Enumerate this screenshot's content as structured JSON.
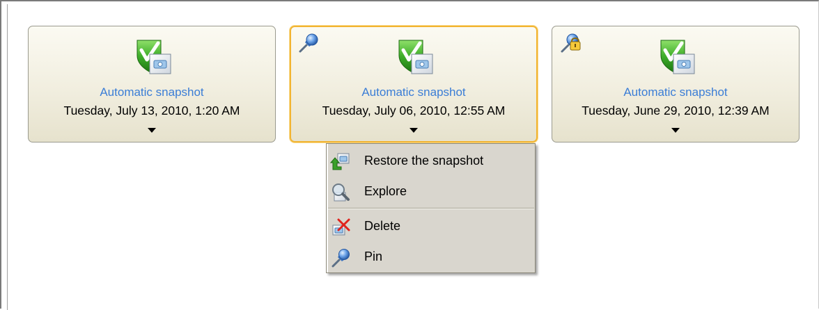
{
  "snapshots": [
    {
      "title": "Automatic snapshot",
      "date": "Tuesday, July 13, 2010, 1:20 AM",
      "selected": false,
      "corner_icon": null
    },
    {
      "title": "Automatic snapshot",
      "date": "Tuesday, July 06, 2010, 12:55 AM",
      "selected": true,
      "corner_icon": "pin-icon"
    },
    {
      "title": "Automatic snapshot",
      "date": "Tuesday, June 29, 2010, 12:39 AM",
      "selected": false,
      "corner_icon": "locked-pin-icon"
    }
  ],
  "context_menu": {
    "items": [
      {
        "label": "Restore the snapshot",
        "icon": "restore-icon"
      },
      {
        "label": "Explore",
        "icon": "magnifier-icon"
      },
      {
        "label": "Delete",
        "icon": "delete-icon"
      },
      {
        "label": "Pin",
        "icon": "pin-icon"
      }
    ]
  },
  "colors": {
    "title_link": "#3a7dd6",
    "selected_border": "#f2b431",
    "card_background": "#f1eedf",
    "menu_background": "#d9d6ce",
    "shield_green": "#3fae2a"
  }
}
